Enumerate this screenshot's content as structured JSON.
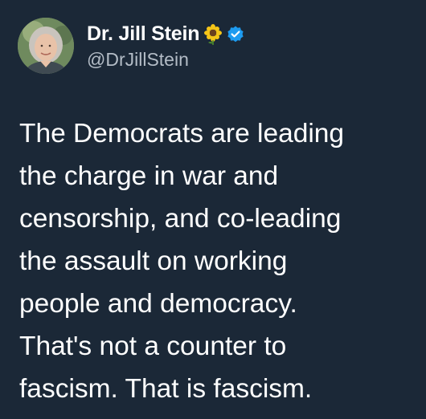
{
  "author": {
    "display_name": "Dr. Jill Stein",
    "handle": "@DrJillStein",
    "avatar_icon": "profile-photo",
    "badge_icons": [
      "sunflower-icon",
      "verified-icon"
    ],
    "verified_color": "#1d9bf0"
  },
  "tweet": {
    "text": "The Democrats are leading\nthe charge in war and\ncensorship, and co-leading\nthe assault on working\npeople and democracy.\nThat's not a counter to\nfascism. That is fascism."
  },
  "colors": {
    "background": "#1b2837",
    "text_primary": "#ffffff",
    "text_secondary": "#b3bcc6"
  }
}
